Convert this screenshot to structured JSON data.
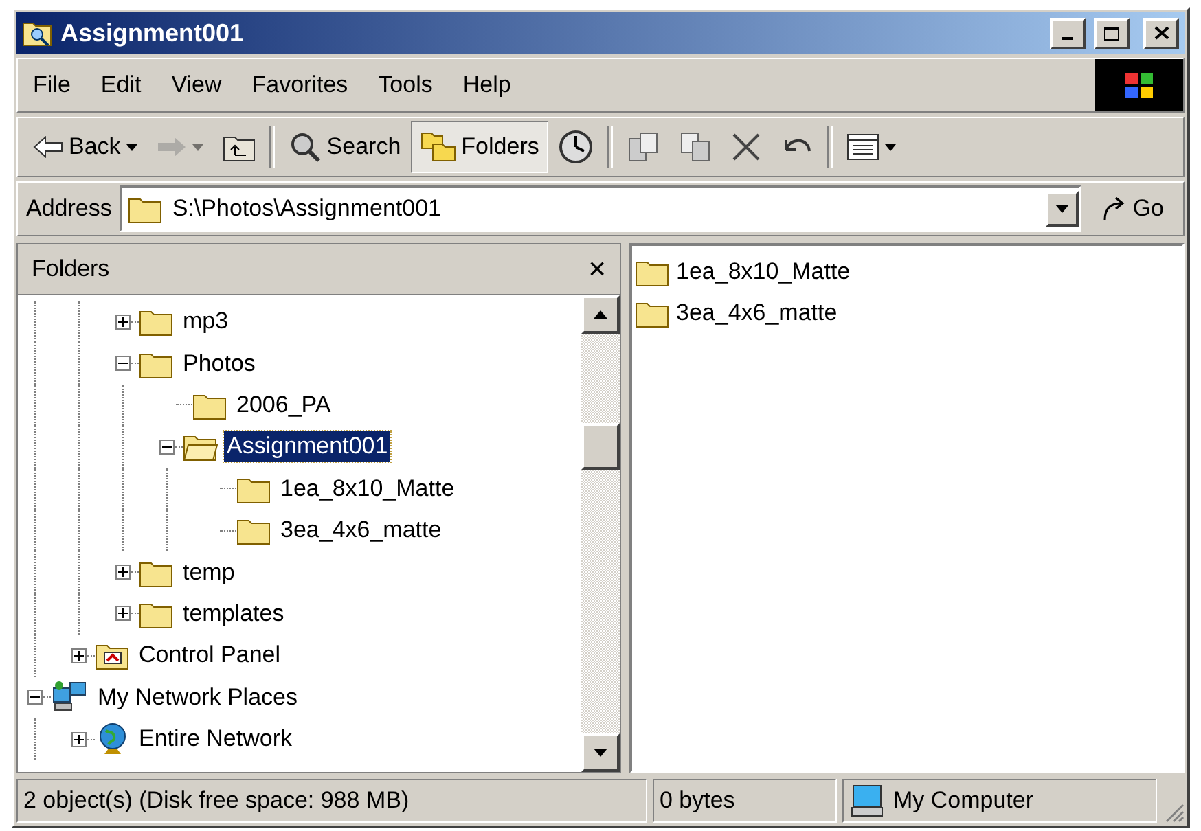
{
  "window": {
    "title": "Assignment001"
  },
  "menu": [
    "File",
    "Edit",
    "View",
    "Favorites",
    "Tools",
    "Help"
  ],
  "toolbar": [
    {
      "kind": "back",
      "label": "Back",
      "dropdown": true,
      "disabled": false,
      "pressed": false
    },
    {
      "kind": "forward",
      "dropdown": true,
      "disabled": true,
      "pressed": false
    },
    {
      "kind": "up",
      "disabled": false,
      "pressed": false
    },
    {
      "kind": "separator"
    },
    {
      "kind": "search",
      "label": "Search",
      "disabled": false,
      "pressed": false
    },
    {
      "kind": "folders",
      "label": "Folders",
      "disabled": false,
      "pressed": true
    },
    {
      "kind": "history",
      "disabled": false,
      "pressed": false
    },
    {
      "kind": "separator"
    },
    {
      "kind": "move",
      "disabled": false,
      "pressed": false
    },
    {
      "kind": "copy",
      "disabled": false,
      "pressed": false
    },
    {
      "kind": "delete",
      "disabled": false,
      "pressed": false
    },
    {
      "kind": "undo",
      "disabled": false,
      "pressed": false
    },
    {
      "kind": "separator"
    },
    {
      "kind": "views",
      "dropdown": true,
      "disabled": false,
      "pressed": false
    }
  ],
  "address": {
    "label": "Address",
    "value": "S:\\Photos\\Assignment001",
    "go": "Go"
  },
  "folders_pane": {
    "title": "Folders",
    "close": "×",
    "tree": [
      {
        "children": [
          {
            "children": [
              {
                "label": "mp3",
                "kind": "folder",
                "expanded": false,
                "selected": false
              },
              {
                "label": "Photos",
                "kind": "folder",
                "expanded": true,
                "selected": false,
                "children": [
                  {
                    "label": "2006_PA",
                    "kind": "folder",
                    "selected": false
                  },
                  {
                    "label": "Assignment001",
                    "kind": "open_folder",
                    "expanded": true,
                    "selected": true,
                    "children": [
                      {
                        "label": "1ea_8x10_Matte",
                        "kind": "folder",
                        "selected": false
                      },
                      {
                        "label": "3ea_4x6_matte",
                        "kind": "folder",
                        "selected": false
                      }
                    ]
                  }
                ]
              },
              {
                "label": "temp",
                "kind": "folder",
                "expanded": false,
                "selected": false
              },
              {
                "label": "templates",
                "kind": "folder",
                "expanded": false,
                "selected": false
              }
            ]
          },
          {
            "label": "Control Panel",
            "kind": "control_panel",
            "expanded": false,
            "selected": false
          }
        ]
      },
      {
        "label": "My Network Places",
        "kind": "network",
        "expanded": true,
        "selected": false,
        "children": [
          {
            "label": "Entire Network",
            "kind": "globe",
            "expanded": false,
            "selected": false
          }
        ]
      }
    ]
  },
  "files": [
    {
      "label": "1ea_8x10_Matte"
    },
    {
      "label": "3ea_4x6_matte"
    }
  ],
  "status_bar": {
    "objects": "2 object(s) (Disk free space: 988 MB)",
    "size": "0 bytes",
    "zone": "My Computer"
  }
}
